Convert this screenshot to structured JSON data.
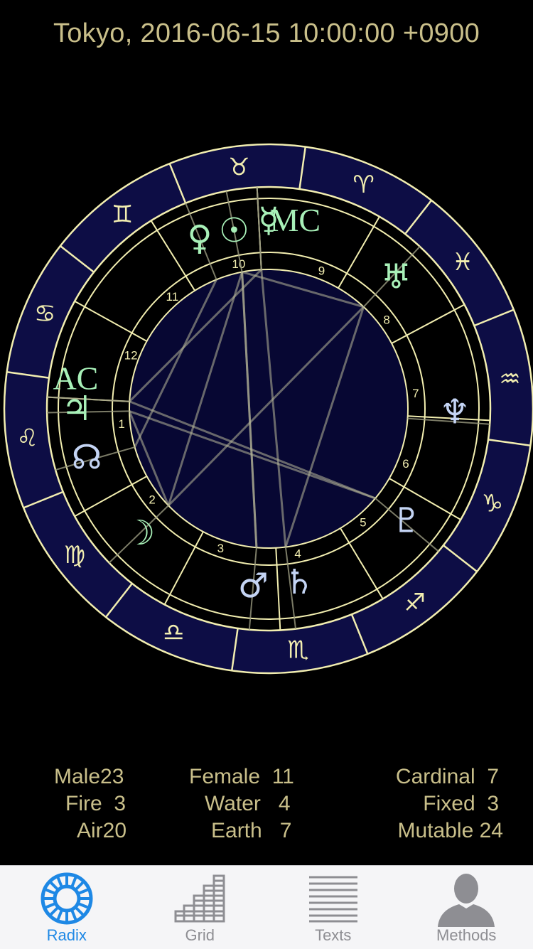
{
  "header": {
    "title": "Tokyo, 2016-06-15 10:00:00 +0900"
  },
  "wheel": {
    "zodiac_signs": [
      {
        "name": "aries",
        "glyph": "♈"
      },
      {
        "name": "taurus",
        "glyph": "♉"
      },
      {
        "name": "gemini",
        "glyph": "♊"
      },
      {
        "name": "cancer",
        "glyph": "♋"
      },
      {
        "name": "leo",
        "glyph": "♌"
      },
      {
        "name": "virgo",
        "glyph": "♍"
      },
      {
        "name": "libra",
        "glyph": "♎"
      },
      {
        "name": "scorpio",
        "glyph": "♏"
      },
      {
        "name": "sagittarius",
        "glyph": "♐"
      },
      {
        "name": "capricorn",
        "glyph": "♑"
      },
      {
        "name": "aquarius",
        "glyph": "♒"
      },
      {
        "name": "pisces",
        "glyph": "♓"
      }
    ],
    "house_numbers": [
      "1",
      "2",
      "3",
      "4",
      "5",
      "6",
      "7",
      "8",
      "9",
      "10",
      "11",
      "12"
    ],
    "points": [
      {
        "name": "venus",
        "glyph": "♀",
        "color": "#a8f0b8"
      },
      {
        "name": "sun",
        "glyph": "☉",
        "color": "#a8f0b8"
      },
      {
        "name": "mercury",
        "glyph": "☿",
        "color": "#a8f0b8"
      },
      {
        "name": "mc",
        "glyph": "MC",
        "color": "#a8f0b8"
      },
      {
        "name": "uranus",
        "glyph": "♅",
        "color": "#a8f0b8"
      },
      {
        "name": "neptune",
        "glyph": "♆",
        "color": "#c4d4f4"
      },
      {
        "name": "pluto",
        "glyph": "♇",
        "color": "#c4d4f4"
      },
      {
        "name": "saturn",
        "glyph": "♄",
        "color": "#c4d4f4"
      },
      {
        "name": "mars",
        "glyph": "♂",
        "color": "#c4d4f4"
      },
      {
        "name": "moon",
        "glyph": "☽",
        "color": "#a8f0b8"
      },
      {
        "name": "node",
        "glyph": "☊",
        "color": "#c4d4f4"
      },
      {
        "name": "jupiter",
        "glyph": "♃",
        "color": "#a8f0b8"
      },
      {
        "name": "ac",
        "glyph": "AC",
        "color": "#a8f0b8"
      }
    ]
  },
  "stats": {
    "male": {
      "label": "Male",
      "value": "23"
    },
    "fire": {
      "label": "Fire",
      "value": "3"
    },
    "air": {
      "label": "Air",
      "value": "20"
    },
    "female": {
      "label": "Female",
      "value": "11"
    },
    "water": {
      "label": "Water",
      "value": "4"
    },
    "earth": {
      "label": "Earth",
      "value": "7"
    },
    "cardinal": {
      "label": "Cardinal",
      "value": "7"
    },
    "fixed": {
      "label": "Fixed",
      "value": "3"
    },
    "mutable": {
      "label": "Mutable",
      "value": "24"
    }
  },
  "tabbar": {
    "tabs": [
      {
        "label": "Radix",
        "icon": "radix-wheel-icon",
        "active": true
      },
      {
        "label": "Grid",
        "icon": "grid-steps-icon",
        "active": false
      },
      {
        "label": "Texts",
        "icon": "text-lines-icon",
        "active": false
      },
      {
        "label": "Methods",
        "icon": "person-silhouette-icon",
        "active": false
      }
    ]
  },
  "colors": {
    "line": "#f2eeb0",
    "ring": "#0d0d45",
    "inner": "#070733",
    "text": "#c9bf8a",
    "aspect": "#b8b89a",
    "accent": "#1e88e5"
  }
}
